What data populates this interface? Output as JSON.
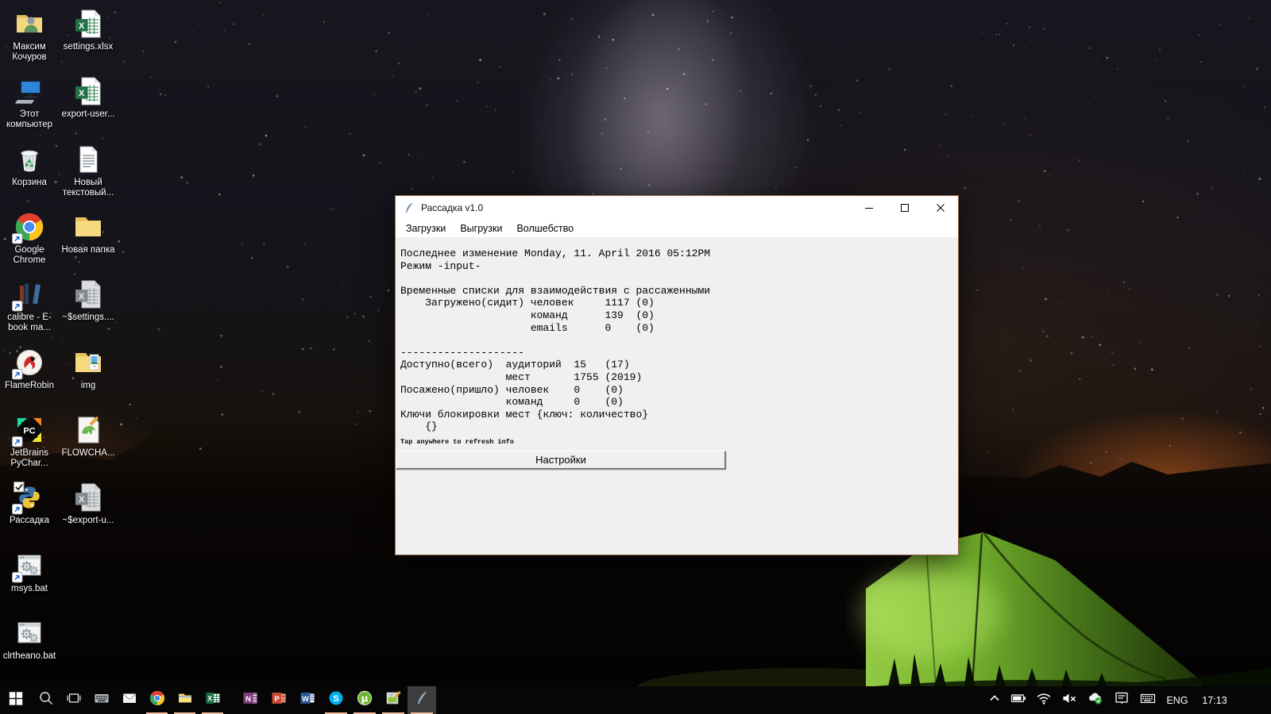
{
  "wallpaper": {
    "tent_green": "#7ab62f",
    "horizon_glow_orange": "#c86423",
    "milkyway_tint": "#a89eb2",
    "accent_underline": "#eebb9f",
    "window_border": "#9a6a43"
  },
  "desktop_icons": [
    {
      "col": 1,
      "row": 1,
      "label": "Максим Кочуров",
      "icon": "user-folder",
      "shortcut": false
    },
    {
      "col": 1,
      "row": 2,
      "label": "Этот компьютер",
      "icon": "computer",
      "shortcut": false
    },
    {
      "col": 1,
      "row": 3,
      "label": "Корзина",
      "icon": "recycle-bin",
      "shortcut": false
    },
    {
      "col": 1,
      "row": 4,
      "label": "Google Chrome",
      "icon": "chrome",
      "shortcut": true
    },
    {
      "col": 1,
      "row": 5,
      "label": "calibre - E-book ma...",
      "icon": "calibre",
      "shortcut": true
    },
    {
      "col": 1,
      "row": 6,
      "label": "FlameRobin",
      "icon": "flamerobin",
      "shortcut": true
    },
    {
      "col": 1,
      "row": 7,
      "label": "JetBrains PyChar...",
      "icon": "pycharm",
      "shortcut": true
    },
    {
      "col": 1,
      "row": 8,
      "label": "Рассадка",
      "icon": "python-file",
      "shortcut": true
    },
    {
      "col": 1,
      "row": 9,
      "label": "msys.bat",
      "icon": "bat-file",
      "shortcut": true
    },
    {
      "col": 1,
      "row": 10,
      "label": "clrtheano.bat",
      "icon": "bat-file",
      "shortcut": false
    },
    {
      "col": 2,
      "row": 1,
      "label": "settings.xlsx",
      "icon": "excel-file",
      "shortcut": false
    },
    {
      "col": 2,
      "row": 2,
      "label": "export-user...",
      "icon": "excel-file",
      "shortcut": false
    },
    {
      "col": 2,
      "row": 3,
      "label": "Новый текстовый...",
      "icon": "text-file",
      "shortcut": false
    },
    {
      "col": 2,
      "row": 4,
      "label": "Новая папка",
      "icon": "folder",
      "shortcut": false
    },
    {
      "col": 2,
      "row": 5,
      "label": "~$settings....",
      "icon": "excel-temp",
      "shortcut": false
    },
    {
      "col": 2,
      "row": 6,
      "label": "img",
      "icon": "img-folder",
      "shortcut": false
    },
    {
      "col": 2,
      "row": 7,
      "label": "FLOWCHA...",
      "icon": "npp-file",
      "shortcut": false
    },
    {
      "col": 2,
      "row": 8,
      "label": "~$export-u...",
      "icon": "excel-temp",
      "shortcut": false
    }
  ],
  "window": {
    "title": "Рассадка v1.0",
    "app_icon": "python-feather",
    "controls": [
      "minimize",
      "maximize",
      "close"
    ],
    "menu": [
      "Загрузки",
      "Выгрузки",
      "Волшебство"
    ],
    "body_lines": [
      "Последнее изменение Monday, 11. April 2016 05:12PM",
      "Режим -input-",
      "",
      "Временные списки для взаимодействия с рассаженными",
      "    Загружено(сидит) человек     1117 (0)",
      "                     команд      139  (0)",
      "                     emails      0    (0)",
      "",
      "--------------------",
      "Доступно(всего)  аудиторий  15   (17)",
      "                 мест       1755 (2019)",
      "Посажено(пришло) человек    0    (0)",
      "                 команд     0    (0)",
      "Ключи блокировки мест {ключ: количество}",
      "    {}"
    ],
    "note": "Tap anywhere to refresh info",
    "settings_button": "Настройки"
  },
  "taskbar": {
    "items": [
      {
        "name": "start",
        "icon": "windows-logo",
        "running": false,
        "active": false
      },
      {
        "name": "search",
        "icon": "search",
        "running": false,
        "active": false
      },
      {
        "name": "task-view",
        "icon": "task-view",
        "running": false,
        "active": false
      },
      {
        "name": "touch-keyboard-app",
        "icon": "keyboard",
        "running": false,
        "active": false
      },
      {
        "name": "mail",
        "icon": "mail",
        "running": false,
        "active": false
      },
      {
        "name": "chrome",
        "icon": "chrome",
        "running": true,
        "active": false
      },
      {
        "name": "file-explorer",
        "icon": "explorer",
        "running": true,
        "active": false
      },
      {
        "name": "excel",
        "icon": "excel",
        "running": true,
        "active": false,
        "gap_after": true
      },
      {
        "name": "onenote",
        "icon": "onenote",
        "running": false,
        "active": false
      },
      {
        "name": "powerpoint",
        "icon": "powerpoint",
        "running": false,
        "active": false
      },
      {
        "name": "word",
        "icon": "word",
        "running": false,
        "active": false
      },
      {
        "name": "skype",
        "icon": "skype",
        "running": true,
        "active": false
      },
      {
        "name": "utorrent",
        "icon": "utorrent",
        "running": true,
        "active": false
      },
      {
        "name": "notepad-plus-plus",
        "icon": "npp",
        "running": true,
        "active": false
      },
      {
        "name": "python-rassadka",
        "icon": "python",
        "running": true,
        "active": true
      }
    ],
    "tray_icons": [
      "hidden-icons-chevron",
      "battery",
      "wifi",
      "volume-muted",
      "onedrive-cloud",
      "action-center",
      "touch-keyboard"
    ],
    "language": "ENG",
    "time": "17:13"
  }
}
